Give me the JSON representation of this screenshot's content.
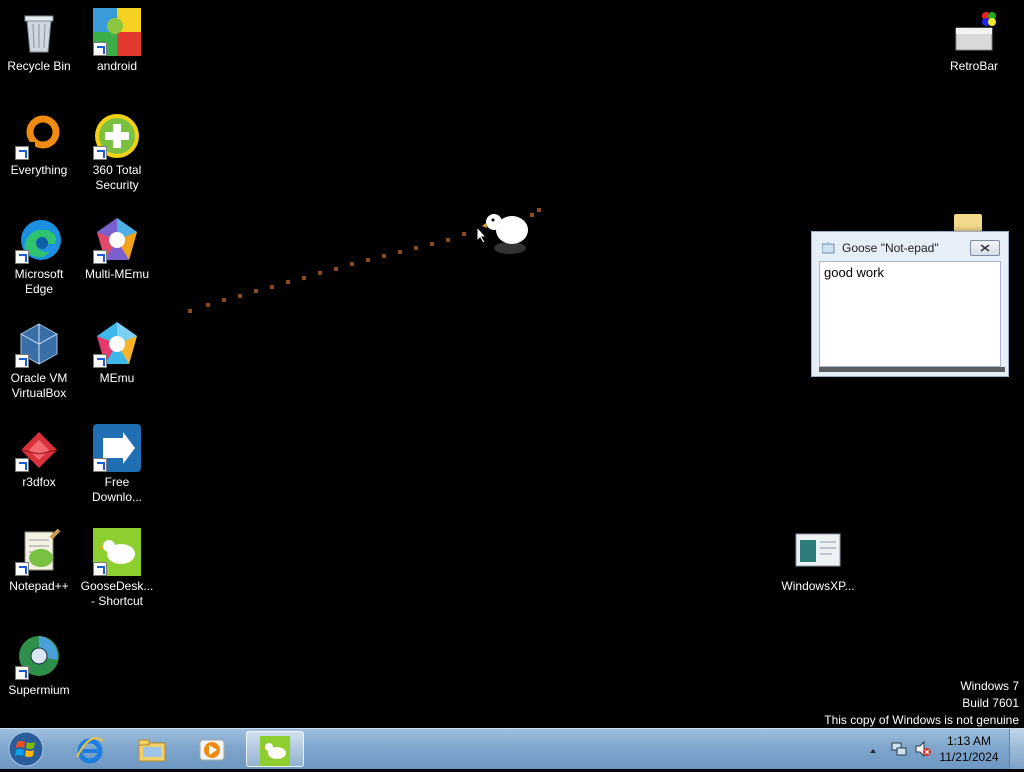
{
  "desktop_icons": {
    "recycle_bin": "Recycle Bin",
    "android": "android",
    "everything": "Everything",
    "total_security": "360 Total Security",
    "edge": "Microsoft Edge",
    "multi_memu": "Multi-MEmu",
    "virtualbox": "Oracle VM VirtualBox",
    "memu": "MEmu",
    "r3dfox": "r3dfox",
    "free_download": "Free Downlo...",
    "notepadpp": "Notepad++",
    "goose_desktop": "GooseDesk... - Shortcut",
    "supermium": "Supermium",
    "retrobar": "RetroBar",
    "windowsxp": "WindowsXP..."
  },
  "goose_note": {
    "title": "Goose \"Not-epad\"",
    "text": "good work"
  },
  "watermark": {
    "line1": "Windows 7",
    "line2": "Build 7601",
    "line3": "This copy of Windows is not genuine"
  },
  "taskbar": {
    "time": "1:13 AM",
    "date": "11/21/2024"
  },
  "colors": {
    "desktop_bg": "#000000",
    "taskbar": "#7fa6cc",
    "goose_trail": "#8b4a1e"
  }
}
